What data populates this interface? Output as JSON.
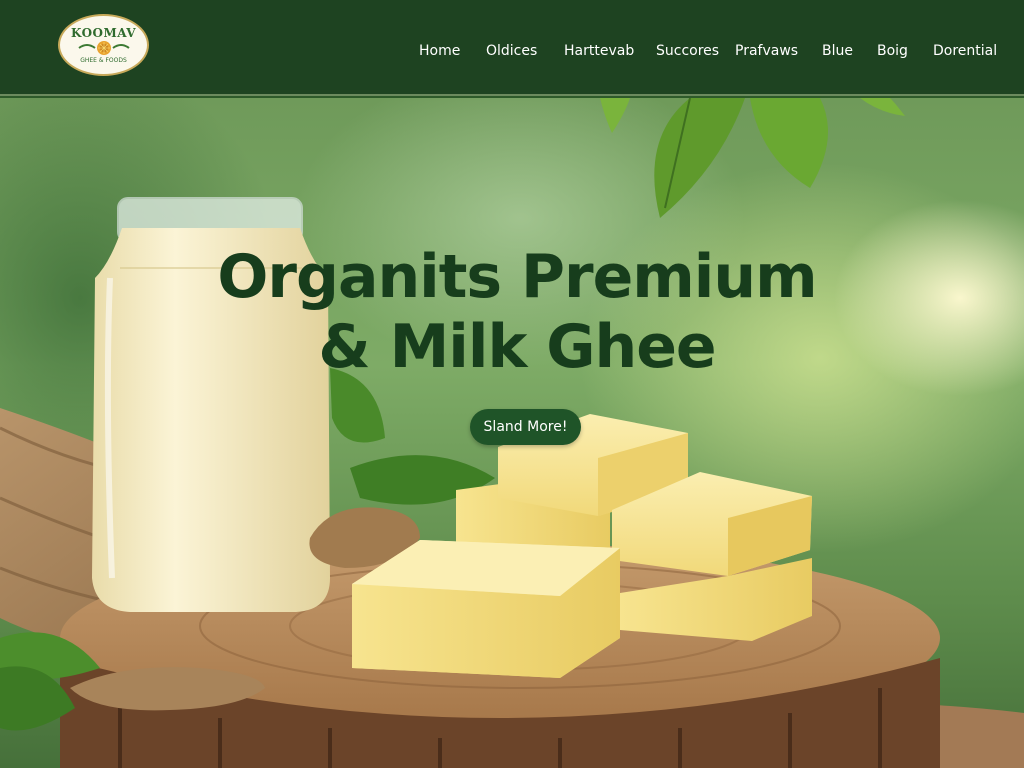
{
  "logo": {
    "title": "KOOMAV",
    "subtitle": "GHEE & FOODS"
  },
  "nav": {
    "items": [
      "Home",
      "Oldices",
      "Harttevab",
      "Succores",
      "Prafvaws",
      "Blue",
      "Boig",
      "Dorential"
    ]
  },
  "hero": {
    "title_line1": "Organits Premium",
    "title_line2": "& Milk Ghee",
    "cta_label": "Sland More!"
  },
  "colors": {
    "header_bg": "#1e4321",
    "title_color": "#173d1c",
    "cta_bg": "#1f5428",
    "ghee": "#f6e39a",
    "milk": "#f4eccb"
  },
  "icons": {
    "logo_emblem": "sun-flower-emblem"
  }
}
